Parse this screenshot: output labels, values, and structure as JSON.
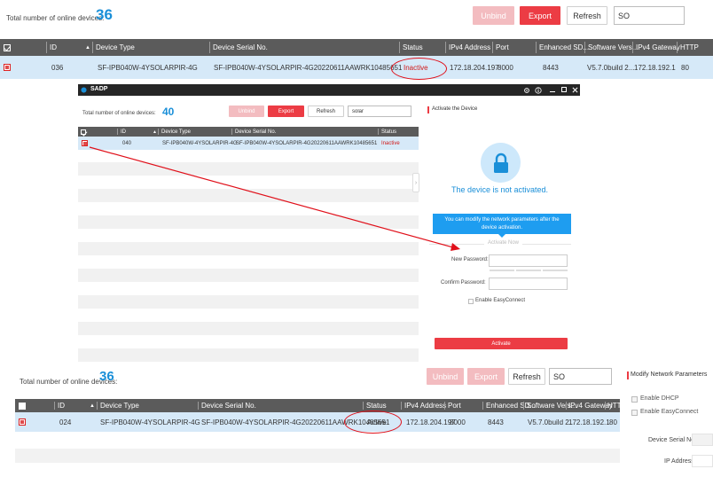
{
  "panel1": {
    "count_label": "Total number of online devices:",
    "count_value": "36",
    "buttons": {
      "unbind": "Unbind",
      "export": "Export",
      "refresh": "Refresh"
    },
    "search_value": "SO",
    "columns": [
      "ID",
      "Device Type",
      "Device Serial No.",
      "Status",
      "IPv4 Address",
      "Port",
      "Enhanced SD...",
      "Software Vers...",
      "IPv4 Gateway",
      "HTTP"
    ],
    "row": {
      "id": "036",
      "device_type": "SF-IPB040W-4YSOLARPIR-4G",
      "serial": "SF-IPB040W-4YSOLARPIR-4G20220611AAWRK10485651",
      "status": "Inactive",
      "ipv4": "172.18.204.197",
      "port": "8000",
      "enhanced": "8443",
      "software": "V5.7.0build 2...",
      "gateway": "172.18.192.1",
      "http": "80"
    }
  },
  "panel2": {
    "app_title": "SADP",
    "count_label": "Total number of online devices:",
    "count_value": "40",
    "buttons": {
      "unbind": "Unbind",
      "export": "Export",
      "refresh": "Refresh"
    },
    "search_value": "solar",
    "columns": [
      "ID",
      "Device Type",
      "Device Serial No.",
      "Status"
    ],
    "row": {
      "id": "040",
      "device_type": "SF-IPB040W-4YSOLARPIR-4G",
      "serial": "SF-IPB040W-4YSOLARPIR-4G20220611AAWRK10485651",
      "status": "Inactive"
    },
    "activate": {
      "heading": "Activate the Device",
      "not_activated": "The device is not activated.",
      "info": "You can modify the network parameters after the device activation.",
      "activate_now": "Activate Now",
      "new_password_label": "New Password:",
      "confirm_password_label": "Confirm Password:",
      "easyconnect_label": "Enable EasyConnect",
      "activate_button": "Activate"
    },
    "colors": {
      "accent": "#1a8fd8",
      "info_bg": "#1e9df0",
      "danger": "#ec3c44"
    }
  },
  "panel3": {
    "count_label": "Total number of online devices:",
    "count_value": "36",
    "buttons": {
      "unbind": "Unbind",
      "export": "Export",
      "refresh": "Refresh"
    },
    "search_value": "SO",
    "columns": [
      "ID",
      "Device Type",
      "Device Serial No.",
      "Status",
      "IPv4 Address",
      "Port",
      "Enhanced SD...",
      "Software Vers...",
      "IPv4 Gateway",
      "HTTP"
    ],
    "row": {
      "id": "024",
      "device_type": "SF-IPB040W-4YSOLARPIR-4G",
      "serial": "SF-IPB040W-4YSOLARPIR-4G20220611AAWRK10485651",
      "status": "Active",
      "ipv4": "172.18.204.197",
      "port": "8000",
      "enhanced": "8443",
      "software": "V5.7.0build 2...",
      "gateway": "172.18.192.1",
      "http": "80"
    },
    "modify": {
      "heading": "Modify Network Parameters",
      "dhcp_label": "Enable DHCP",
      "easyconnect_label": "Enable EasyConnect",
      "serial_label": "Device Serial No.:",
      "ip_label": "IP Address:"
    }
  }
}
